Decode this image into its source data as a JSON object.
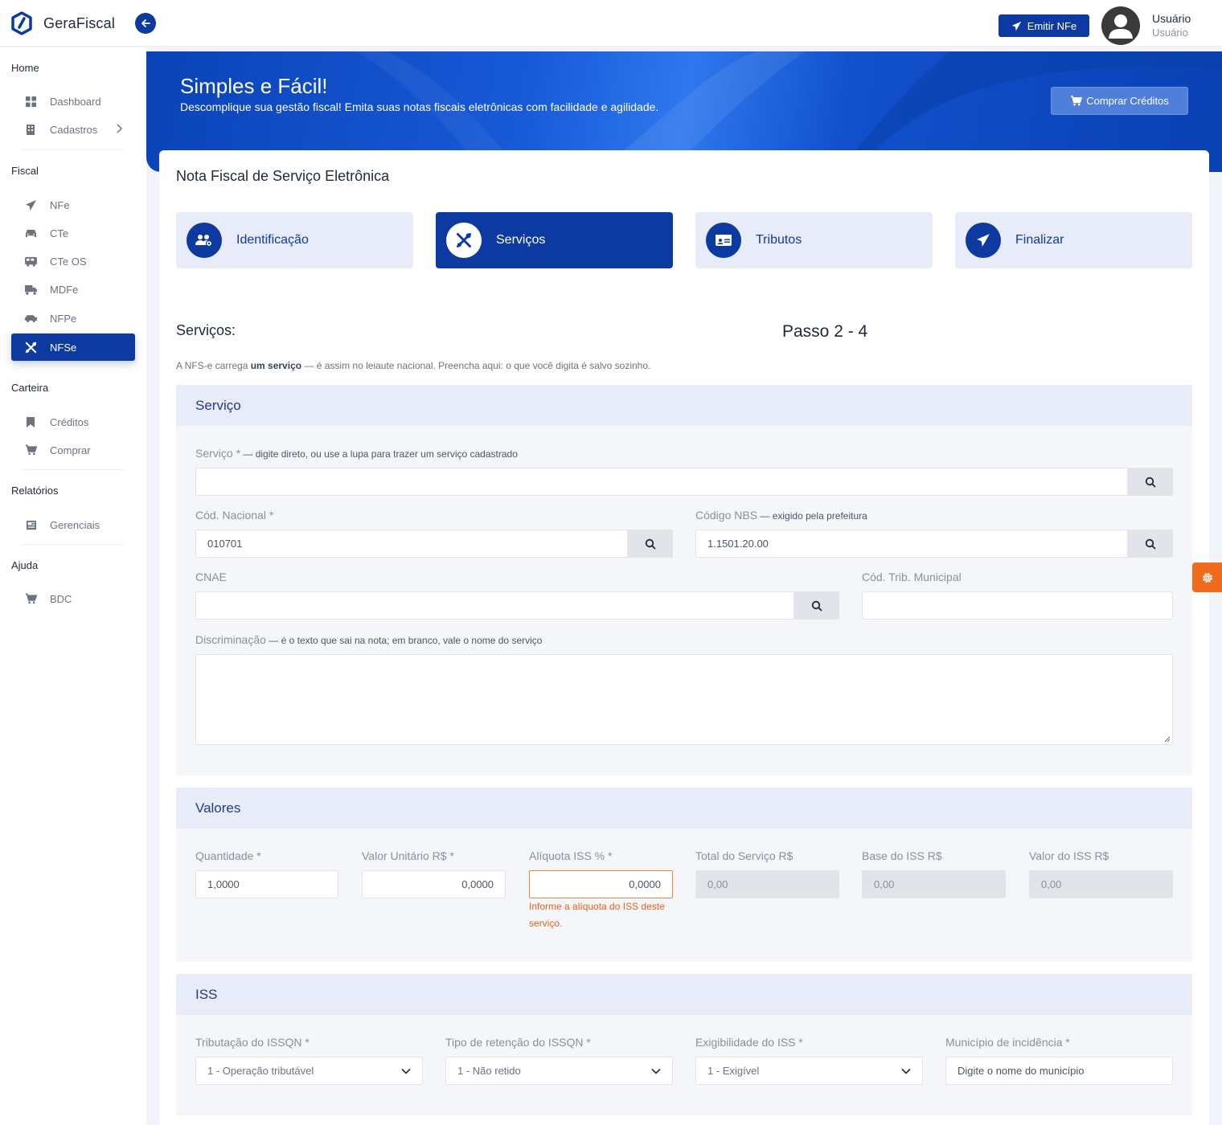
{
  "app": {
    "name": "GeraFiscal"
  },
  "header": {
    "emit_button": "Emitir NFe",
    "user_name": "Usuário",
    "user_role": "Usuário"
  },
  "sidebar": {
    "sections": [
      {
        "title": "Home",
        "items": [
          {
            "label": "Dashboard",
            "icon": "dashboard-icon"
          },
          {
            "label": "Cadastros",
            "icon": "building-icon"
          }
        ]
      },
      {
        "title": "Fiscal",
        "items": [
          {
            "label": "NFe",
            "icon": "paper-plane-icon"
          },
          {
            "label": "CTe",
            "icon": "car-icon"
          },
          {
            "label": "CTe OS",
            "icon": "bus-icon"
          },
          {
            "label": "MDFe",
            "icon": "truck-icon"
          },
          {
            "label": "NFPe",
            "icon": "car-side-icon"
          },
          {
            "label": "NFSe",
            "icon": "tools-icon"
          }
        ]
      },
      {
        "title": "Carteira",
        "items": [
          {
            "label": "Créditos",
            "icon": "bookmark-icon"
          },
          {
            "label": "Comprar",
            "icon": "cart-icon"
          }
        ]
      },
      {
        "title": "Relatórios",
        "items": [
          {
            "label": "Gerenciais",
            "icon": "newspaper-icon"
          }
        ]
      },
      {
        "title": "Ajuda",
        "items": [
          {
            "label": "BDC",
            "icon": "cart-icon"
          }
        ]
      }
    ],
    "active": "NFSe"
  },
  "banner": {
    "title": "Simples e Fácil!",
    "subtitle": "Descomplique sua gestão fiscal! Emita suas notas fiscais eletrônicas com facilidade e agilidade.",
    "buy_button": "Comprar Créditos"
  },
  "card": {
    "title": "Nota Fiscal de Serviço Eletrônica",
    "steps": [
      {
        "label": "Identificação",
        "icon": "users-cog-icon"
      },
      {
        "label": "Serviços",
        "icon": "tools-icon"
      },
      {
        "label": "Tributos",
        "icon": "id-card-icon"
      },
      {
        "label": "Finalizar",
        "icon": "paper-plane-icon"
      }
    ],
    "active_step": "Serviços",
    "section_heading": "Serviços:",
    "step_count": "Passo 2 - 4",
    "intro": {
      "before": "A NFS-e carrega ",
      "bold": "um serviço",
      "after": " — é assim no leiaute nacional. Preencha aqui: o que você digita é salvo sozinho."
    }
  },
  "servico_panel": {
    "title": "Serviço",
    "servico": {
      "label": "Serviço *",
      "hint": " — digite direto, ou use a lupa para trazer um serviço cadastrado",
      "value": ""
    },
    "cod_nacional": {
      "label": "Cód. Nacional *",
      "value": "010701"
    },
    "codigo_nbs": {
      "label": "Código NBS",
      "hint": " — exigido pela prefeitura",
      "value": "1.1501.20.00"
    },
    "cnae": {
      "label": "CNAE",
      "value": ""
    },
    "cod_trib_municipal": {
      "label": "Cód. Trib. Municipal",
      "value": ""
    },
    "discriminacao": {
      "label": "Discriminação",
      "hint": " — é o texto que sai na nota; em branco, vale o nome do serviço",
      "value": ""
    }
  },
  "valores_panel": {
    "title": "Valores",
    "quantidade": {
      "label": "Quantidade *",
      "value": "1,0000"
    },
    "valor_unitario": {
      "label": "Valor Unitário R$ *",
      "value": "0,0000"
    },
    "aliquota_iss": {
      "label": "Alíquota ISS % *",
      "value": "0,0000",
      "error": "Informe a alíquota do ISS deste serviço."
    },
    "total_servico": {
      "label": "Total do Serviço R$",
      "value": "0,00"
    },
    "base_iss": {
      "label": "Base do ISS R$",
      "value": "0,00"
    },
    "valor_iss": {
      "label": "Valor do ISS R$",
      "value": "0,00"
    }
  },
  "iss_panel": {
    "title": "ISS",
    "tributacao": {
      "label": "Tributação do ISSQN *",
      "value": "1 - Operação tributável"
    },
    "retencao": {
      "label": "Tipo de retenção do ISSQN *",
      "value": "1 - Não retido"
    },
    "exigibilidade": {
      "label": "Exigibilidade do ISS *",
      "value": "1 - Exigível"
    },
    "municipio": {
      "label": "Município de incidência *",
      "placeholder": "Digite o nome do município"
    }
  },
  "colors": {
    "primary": "#0d3aa0",
    "accent": "#f06b1c",
    "error": "#e2621b"
  }
}
